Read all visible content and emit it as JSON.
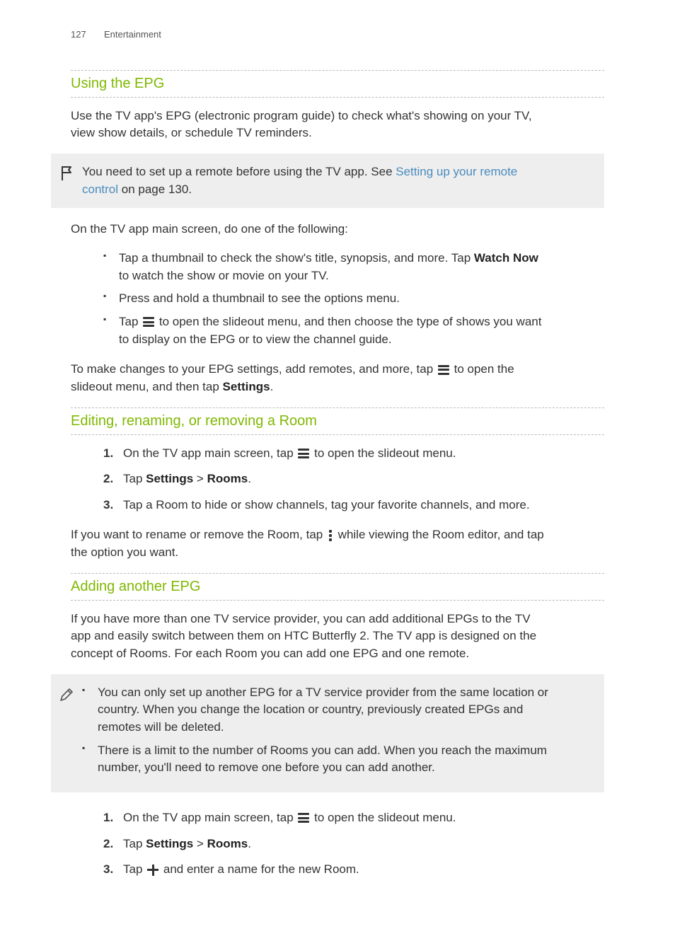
{
  "header": {
    "page": "127",
    "section": "Entertainment"
  },
  "s1": {
    "heading": "Using the EPG",
    "intro": "Use the TV app's EPG (electronic program guide) to check what's showing on your TV, view show details, or schedule TV reminders.",
    "note_pre": "You need to set up a remote before using the TV app. See ",
    "note_link": "Setting up your remote control",
    "note_post": " on page 130.",
    "lead": "On the TV app main screen, do one of the following:",
    "b1_a": "Tap a thumbnail to check the show's title, synopsis, and more. Tap ",
    "b1_bold": "Watch Now",
    "b1_b": " to watch the show or movie on your TV.",
    "b2": "Press and hold a thumbnail to see the options menu.",
    "b3_a": "Tap ",
    "b3_b": " to open the slideout menu, and then choose the type of shows you want to display on the EPG or to view the channel guide.",
    "close_a": "To make changes to your EPG settings, add remotes, and more, tap ",
    "close_b": " to open the slideout menu, and then tap ",
    "close_bold": "Settings",
    "close_c": "."
  },
  "s2": {
    "heading": "Editing, renaming, or removing a Room",
    "step1_a": "On the TV app main screen, tap ",
    "step1_b": " to open the slideout menu.",
    "step2_a": "Tap ",
    "step2_b1": "Settings",
    "step2_mid": " > ",
    "step2_b2": "Rooms",
    "step2_end": ".",
    "step3": "Tap a Room to hide or show channels, tag your favorite channels, and more.",
    "tail_a": "If you want to rename or remove the Room, tap ",
    "tail_b": " while viewing the Room editor, and tap the option you want."
  },
  "s3": {
    "heading": "Adding another EPG",
    "intro": "If you have more than one TV service provider, you can add additional EPGs to the TV app and easily switch between them on HTC Butterfly 2. The TV app is designed on the concept of Rooms. For each Room you can add one EPG and one remote.",
    "n1": "You can only set up another EPG for a TV service provider from the same location or country. When you change the location or country, previously created EPGs and remotes will be deleted.",
    "n2": "There is a limit to the number of Rooms you can add. When you reach the maximum number, you'll need to remove one before you can add another.",
    "step1_a": "On the TV app main screen, tap ",
    "step1_b": " to open the slideout menu.",
    "step2_a": "Tap ",
    "step2_b1": "Settings",
    "step2_mid": " > ",
    "step2_b2": "Rooms",
    "step2_end": ".",
    "step3_a": "Tap ",
    "step3_b": " and enter a name for the new Room."
  }
}
